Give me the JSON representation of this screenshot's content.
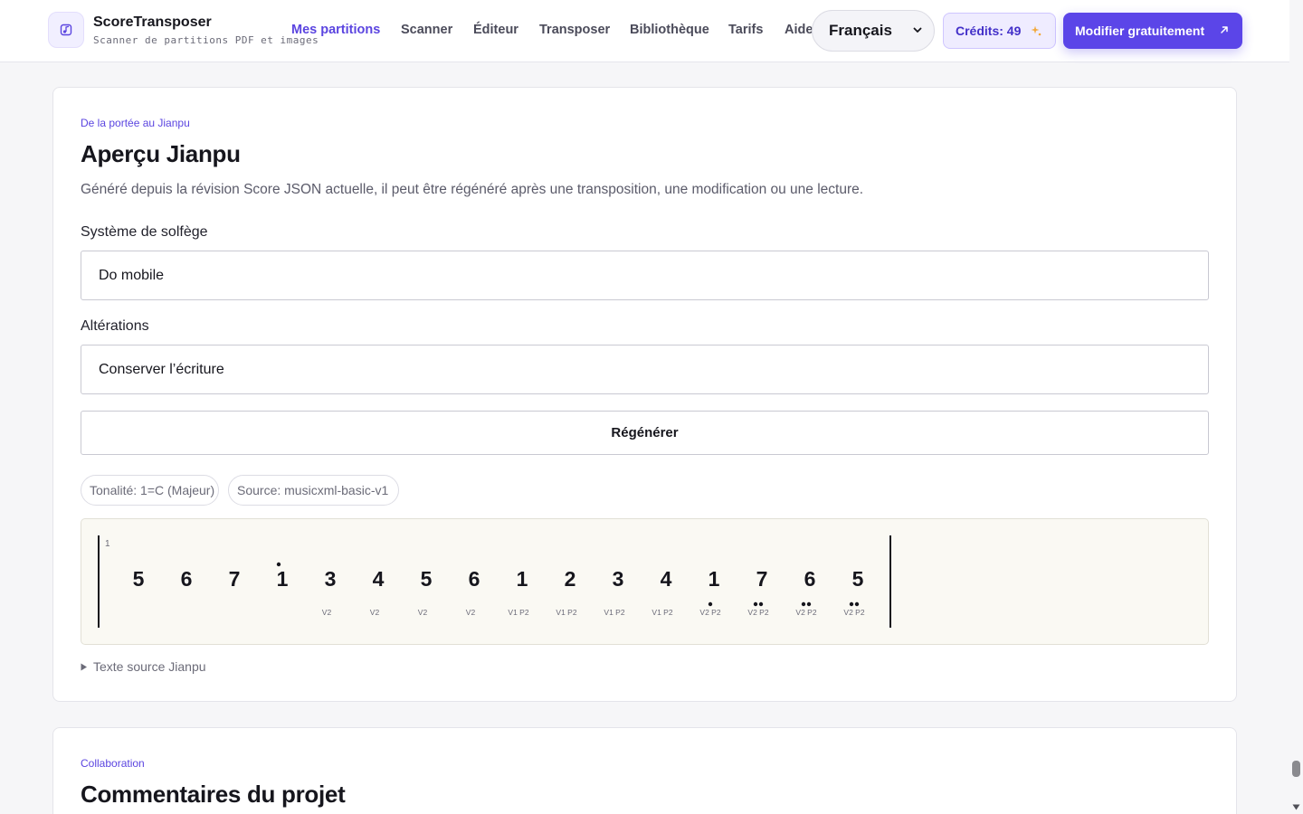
{
  "brand": {
    "name": "ScoreTransposer",
    "tagline": "Scanner de partitions PDF et images"
  },
  "nav": {
    "items": [
      {
        "label": "Mes partitions",
        "active": true
      },
      {
        "label": "Scanner",
        "active": false
      },
      {
        "label": "Éditeur",
        "active": false
      },
      {
        "label": "Transposer",
        "active": false
      },
      {
        "label": "Bibliothèque",
        "active": false
      },
      {
        "label": "Tarifs",
        "active": false
      },
      {
        "label": "Aide",
        "active": false
      }
    ]
  },
  "header": {
    "language": "Français",
    "credits": "Crédits: 49",
    "cta": "Modifier gratuitement"
  },
  "jianpu_card": {
    "eyebrow": "De la portée au Jianpu",
    "title": "Aperçu Jianpu",
    "description": "Généré depuis la révision Score JSON actuelle, il peut être régénéré après une transposition, une modification ou une lecture.",
    "solfege_label": "Système de solfège",
    "solfege_value": "Do mobile",
    "accidentals_label": "Altérations",
    "accidentals_value": "Conserver l’écriture",
    "regenerate": "Régénérer",
    "key_chip": "Tonalité: 1=C (Majeur)",
    "source_chip": "Source: musicxml-basic-v1",
    "source_toggle": "Texte source Jianpu"
  },
  "jianpu": {
    "measure_number": "1",
    "notes": [
      {
        "digit": "5",
        "dots_above": 0,
        "dots_below": 0,
        "label": ""
      },
      {
        "digit": "6",
        "dots_above": 0,
        "dots_below": 0,
        "label": ""
      },
      {
        "digit": "7",
        "dots_above": 0,
        "dots_below": 0,
        "label": ""
      },
      {
        "digit": "1",
        "dots_above": 1,
        "dots_below": 0,
        "label": ""
      },
      {
        "digit": "3",
        "dots_above": 0,
        "dots_below": 0,
        "label": "V2"
      },
      {
        "digit": "4",
        "dots_above": 0,
        "dots_below": 0,
        "label": "V2"
      },
      {
        "digit": "5",
        "dots_above": 0,
        "dots_below": 0,
        "label": "V2"
      },
      {
        "digit": "6",
        "dots_above": 0,
        "dots_below": 0,
        "label": "V2"
      },
      {
        "digit": "1",
        "dots_above": 0,
        "dots_below": 0,
        "label": "V1 P2"
      },
      {
        "digit": "2",
        "dots_above": 0,
        "dots_below": 0,
        "label": "V1 P2"
      },
      {
        "digit": "3",
        "dots_above": 0,
        "dots_below": 0,
        "label": "V1 P2"
      },
      {
        "digit": "4",
        "dots_above": 0,
        "dots_below": 0,
        "label": "V1 P2"
      },
      {
        "digit": "1",
        "dots_above": 0,
        "dots_below": 1,
        "label": "V2 P2"
      },
      {
        "digit": "7",
        "dots_above": 0,
        "dots_below": 2,
        "label": "V2 P2"
      },
      {
        "digit": "6",
        "dots_above": 0,
        "dots_below": 2,
        "label": "V2 P2"
      },
      {
        "digit": "5",
        "dots_above": 0,
        "dots_below": 2,
        "label": "V2 P2"
      }
    ]
  },
  "comments_card": {
    "eyebrow": "Collaboration",
    "title": "Commentaires du projet"
  },
  "colors": {
    "accent": "#5b45e8",
    "accent_text": "#5b45e0",
    "jianpu_bg": "#faf9f3"
  }
}
